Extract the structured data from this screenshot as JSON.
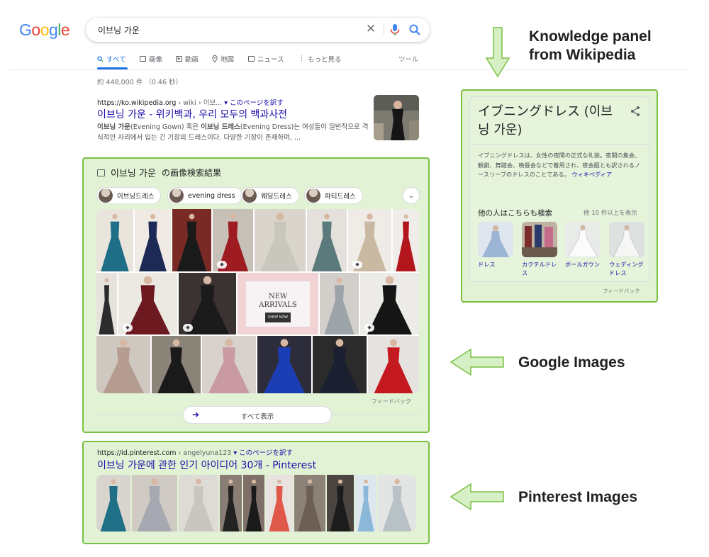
{
  "logo": "Google",
  "search": {
    "query": "이브닝 가운"
  },
  "tabs": [
    {
      "label": "すべて",
      "icon": "search-icon",
      "active": true
    },
    {
      "label": "画像",
      "icon": "image-icon"
    },
    {
      "label": "動画",
      "icon": "video-icon"
    },
    {
      "label": "地図",
      "icon": "map-pin-icon"
    },
    {
      "label": "ニュース",
      "icon": "news-icon"
    },
    {
      "label": "もっと見る",
      "icon": "more-vert-icon"
    }
  ],
  "tools_label": "ツール",
  "result_count": "約 448,000 件 （0.46 秒）",
  "result1": {
    "url": "https://ko.wikipedia.org",
    "crumb": " › wiki › 이브...",
    "translate": "▾ このページを訳す",
    "title": "이브닝 가운 - 위키백과, 우리 모두의 백과사전",
    "snippet_1b": "이브닝 가운",
    "snippet_1": "(Evening Gown) 혹은 ",
    "snippet_1c": "이브닝 드레스",
    "snippet_1d": "(Evening Dress)는 여성들이 일반적으로 격식적인 자리에서 입는 긴 기장의 드레스이다. 다양한 기장이 존재하며, ..."
  },
  "images_section": {
    "heading": "이브닝 가운",
    "heading_suffix": "の画像検索結果",
    "chips": [
      "이브닝드레스",
      "evening dress",
      "웨딩드레스",
      "파티드레스"
    ],
    "new_arrivals_1": "NEW",
    "new_arrivals_2": "ARRIVALS",
    "shop_now": "SHOP NOW",
    "feedback": "フィードバック",
    "show_all": "すべて表示"
  },
  "result2": {
    "url": "https://id.pinterest.com",
    "crumb": " › angelyuna123",
    "translate": "▾ このページを訳す",
    "title": "이브닝 가운에 관한 인기 아이디어 30개 - Pinterest"
  },
  "knowledge_panel": {
    "title": "イブニングドレス (이브닝 가운)",
    "description": "イブニングドレスは、女性の夜間の正式な礼装。夜間の集会、観劇、舞踏会、晩餐会などで着用され、夜会服とも訳されるノースリーブのドレスのことである。",
    "source": "ウィキペディア",
    "people_also_search": "他の人はこちらも検索",
    "more": "他 10 件以上を表示",
    "items": [
      "ドレス",
      "カクテルドレス",
      "ボールガウン",
      "ウェディングドレス"
    ],
    "feedback": "フィードバック"
  },
  "annotations": {
    "knowledge_1": "Knowledge panel",
    "knowledge_2": "from Wikipedia",
    "google_images": "Google Images",
    "pinterest_images": "Pinterest Images"
  },
  "colors": {
    "highlight_border": "#7ac043",
    "highlight_fill": "#d6efc5",
    "link": "#1a0dab",
    "accent": "#1a73e8"
  }
}
